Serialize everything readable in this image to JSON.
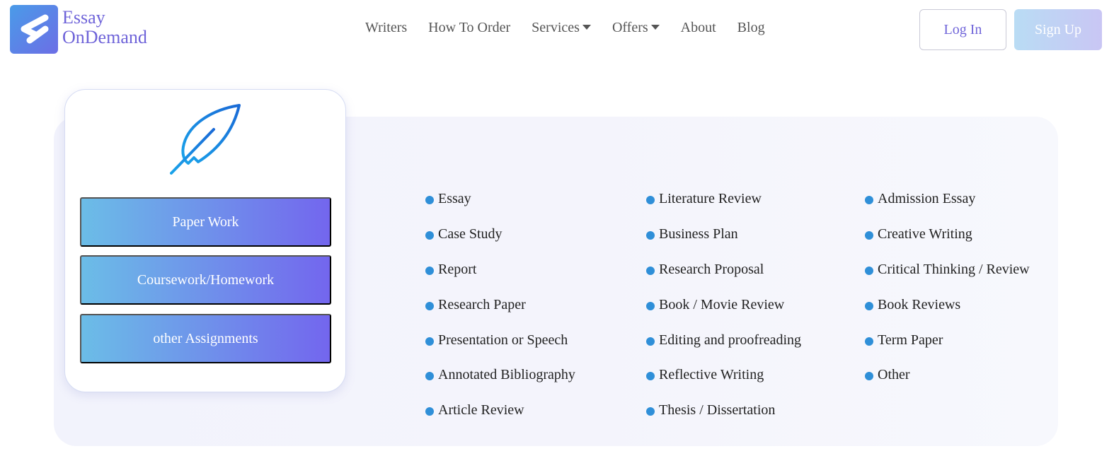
{
  "brand": {
    "line1": "Essay",
    "line2": "OnDemand"
  },
  "nav": {
    "items": [
      {
        "label": "Writers",
        "dropdown": false
      },
      {
        "label": "How To Order",
        "dropdown": false
      },
      {
        "label": "Services",
        "dropdown": true
      },
      {
        "label": "Offers",
        "dropdown": true
      },
      {
        "label": "About",
        "dropdown": false
      },
      {
        "label": "Blog",
        "dropdown": false
      }
    ],
    "login_label": "Log In",
    "signup_label": "Sign Up"
  },
  "card": {
    "icon": "feather-quill-icon",
    "buttons": [
      "Paper Work",
      "Coursework/Homework",
      "other Assignments"
    ]
  },
  "services": {
    "col1": [
      "Essay",
      "Case Study",
      "Report",
      "Research Paper",
      "Presentation or Speech",
      "Annotated Bibliography",
      "Article Review"
    ],
    "col2": [
      "Literature Review",
      "Business Plan",
      "Research Proposal",
      "Book / Movie Review",
      "Editing and proofreading",
      "Reflective Writing",
      "Thesis / Dissertation"
    ],
    "col3": [
      "Admission Essay",
      "Creative Writing",
      "Critical Thinking / Review",
      "Book Reviews",
      "Term Paper",
      "Other"
    ]
  },
  "colors": {
    "accent": "#6f64d9",
    "bullet": "#2f8fd8",
    "gradient_start": "#6bbde7",
    "gradient_end": "#7366ee"
  }
}
